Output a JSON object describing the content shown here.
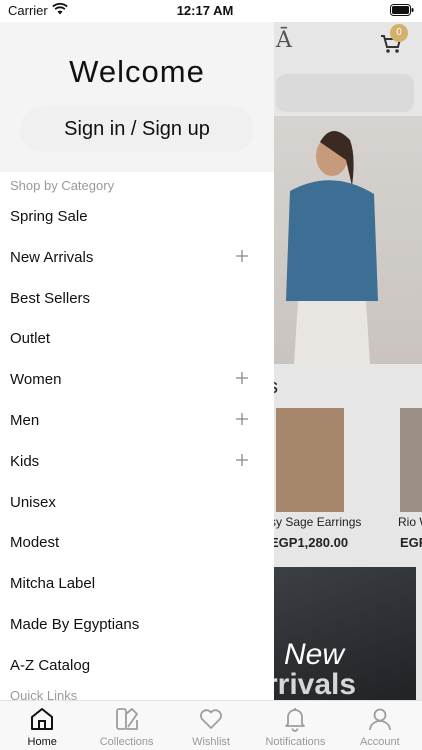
{
  "status_bar": {
    "carrier": "Carrier",
    "time": "12:17 AM"
  },
  "drawer": {
    "welcome": "Welcome",
    "sign_in_label": "Sign in / Sign up",
    "section_shop": "Shop by Category",
    "section_quick": "Quick Links",
    "menu": [
      {
        "label": "Spring Sale",
        "expandable": false
      },
      {
        "label": "New Arrivals",
        "expandable": true
      },
      {
        "label": "Best Sellers",
        "expandable": false
      },
      {
        "label": "Outlet",
        "expandable": false
      },
      {
        "label": "Women",
        "expandable": true
      },
      {
        "label": "Men",
        "expandable": true
      },
      {
        "label": "Kids",
        "expandable": true
      },
      {
        "label": "Unisex",
        "expandable": false
      },
      {
        "label": "Modest",
        "expandable": false
      },
      {
        "label": "Mitcha Label",
        "expandable": false
      },
      {
        "label": "Made By Egyptians",
        "expandable": false
      },
      {
        "label": "A-Z Catalog",
        "expandable": false
      }
    ]
  },
  "background": {
    "logo": "Ā",
    "cart_badge": "0",
    "section_title": "s",
    "products": [
      {
        "name": "sy Sage Earrings",
        "price": "EGP1,280.00"
      },
      {
        "name": "Rio W",
        "price": "EGF"
      }
    ],
    "banner_line1": "New",
    "banner_line2": "rrivals"
  },
  "tab_bar": {
    "tabs": [
      {
        "label": "Home",
        "icon": "home-icon",
        "active": true
      },
      {
        "label": "Collections",
        "icon": "collections-icon",
        "active": false
      },
      {
        "label": "Wishlist",
        "icon": "heart-icon",
        "active": false
      },
      {
        "label": "Notifications",
        "icon": "bell-icon",
        "active": false
      },
      {
        "label": "Account",
        "icon": "account-icon",
        "active": false
      }
    ]
  },
  "colors": {
    "accent_badge": "#d4b06a",
    "drawer_header": "#f4f4f4",
    "muted_text": "#9a9a9a"
  }
}
